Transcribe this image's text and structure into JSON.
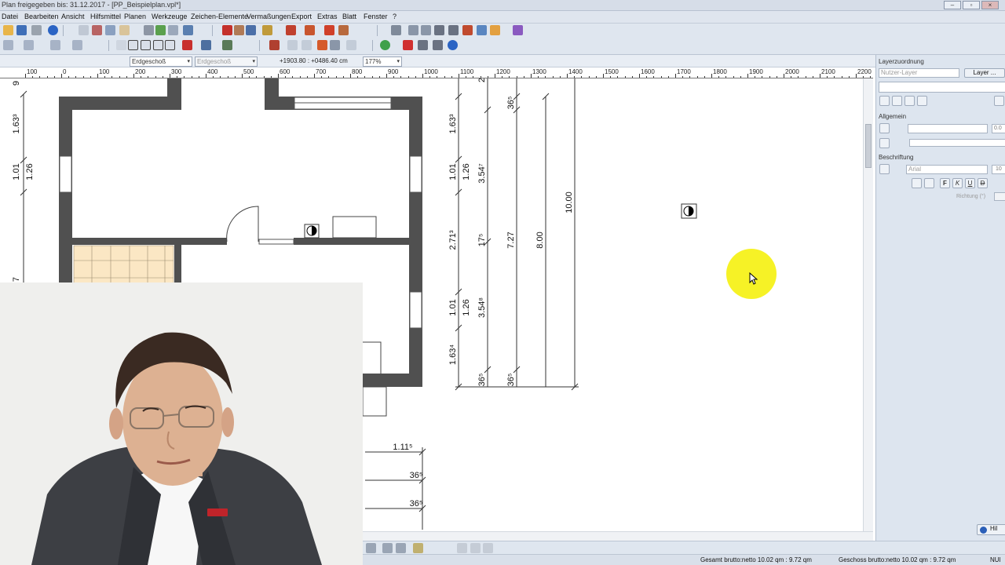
{
  "window": {
    "title": "PP_Beispielplan.vpl*",
    "title_prefix": "Plan freigegeben bis: 31.12.2017 - [",
    "title_suffix": "]",
    "controls": [
      "–",
      "▫",
      "×"
    ]
  },
  "menu": {
    "items": [
      "Datei",
      "Bearbeiten",
      "Ansicht",
      "Hilfsmittel",
      "Planen",
      "Werkzeuge",
      "Zeichen-Elemente",
      "Vermaßungen",
      "Export",
      "Extras",
      "Blatt",
      "Fenster",
      "?"
    ]
  },
  "infobar": {
    "floor_select": "Erdgeschoß",
    "floor_select_2": "Erdgeschoß",
    "coordinates": "+1903.80 : +0486.40 cm",
    "zoom": "177%"
  },
  "ruler": {
    "labels": [
      "100",
      "0",
      "100",
      "200",
      "300",
      "400",
      "500",
      "600",
      "700",
      "800",
      "900",
      "1000",
      "1100",
      "1200",
      "1300",
      "1400",
      "1500",
      "1600",
      "1700",
      "1800",
      "1900",
      "2000",
      "2100",
      "2200"
    ]
  },
  "plan": {
    "left_dims": [
      "9",
      "1.63³",
      "1.01",
      "1.26",
      "7"
    ],
    "right_dims": {
      "col1": [
        "1.63³",
        "1.01",
        "2.71³",
        "1.01",
        "1.63⁴",
        "36⁵"
      ],
      "col2": [
        "1.26",
        "1.26",
        "36⁵"
      ],
      "col3": [
        "3.54⁷",
        "17⁵",
        "3.54⁸"
      ],
      "col4": [
        "36⁵",
        "7.27",
        "36⁵"
      ],
      "col5": [
        "8.00"
      ],
      "col6": [
        "10.00"
      ],
      "top_frag": "2"
    },
    "bottom_dims": [
      "1.11⁵",
      "36⁵",
      "36⁵"
    ]
  },
  "panel": {
    "title": "Layerzuordnung",
    "layer_select": "Nutzer-Layer",
    "layer_button": "Layer ...",
    "section_general": "Allgemein",
    "line_width": "0.0",
    "section_label": "Beschriftung",
    "font_select": "Arial",
    "font_size": "10",
    "format_buttons": [
      "F",
      "K",
      "U",
      "D"
    ],
    "direction_label": "Richtung (°)",
    "help_button": "Hil"
  },
  "status": {
    "total": "Gesamt brutto:netto 10.02 qm : 9.72 qm",
    "floor": "Geschoss brutto:netto 10.02 qm : 9.72 qm",
    "mode": "NUI"
  },
  "colors": {
    "wall": "#505050",
    "tile": "#fbe7c4",
    "accent_yellow": "#f4f000",
    "toolbar_bg": "#dfe6ef"
  }
}
